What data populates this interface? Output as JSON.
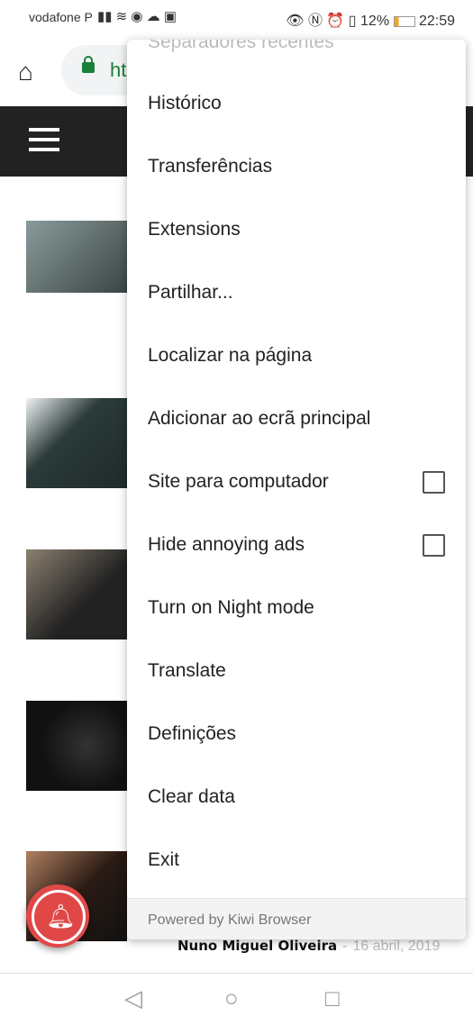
{
  "status": {
    "carrier": "vodafone P",
    "icons_left": [
      "signal-icon",
      "wifi-icon",
      "messenger-icon",
      "cloud-icon",
      "facebook-icon"
    ],
    "icons_right": [
      "eye-icon",
      "nfc-icon",
      "alarm-icon",
      "vibrate-icon"
    ],
    "battery": "12%",
    "time": "22:59"
  },
  "toolbar": {
    "url": "ht"
  },
  "byline": {
    "author": "Nuno Miguel Oliveira",
    "sep": "-",
    "date": "16 abril, 2019"
  },
  "menu": {
    "partial_top": "Separadores recentes",
    "items": [
      {
        "label": "Histórico"
      },
      {
        "label": "Transferências"
      },
      {
        "label": "Extensions"
      },
      {
        "label": "Partilhar..."
      },
      {
        "label": "Localizar na página"
      },
      {
        "label": "Adicionar ao ecrã principal"
      },
      {
        "label": "Site para computador",
        "checkbox": false
      },
      {
        "label": "Hide annoying ads",
        "checkbox": false
      },
      {
        "label": "Turn on Night mode"
      },
      {
        "label": "Translate"
      },
      {
        "label": "Definições"
      },
      {
        "label": "Clear data"
      },
      {
        "label": "Exit"
      }
    ],
    "footer": "Powered by Kiwi Browser"
  },
  "thumbs": [
    {
      "color": "#6b7a7a"
    },
    {
      "color": "#e8edf2"
    },
    {
      "color": "#4a4a48"
    },
    {
      "color": "#151515"
    },
    {
      "color": "#5a3a2a"
    }
  ]
}
